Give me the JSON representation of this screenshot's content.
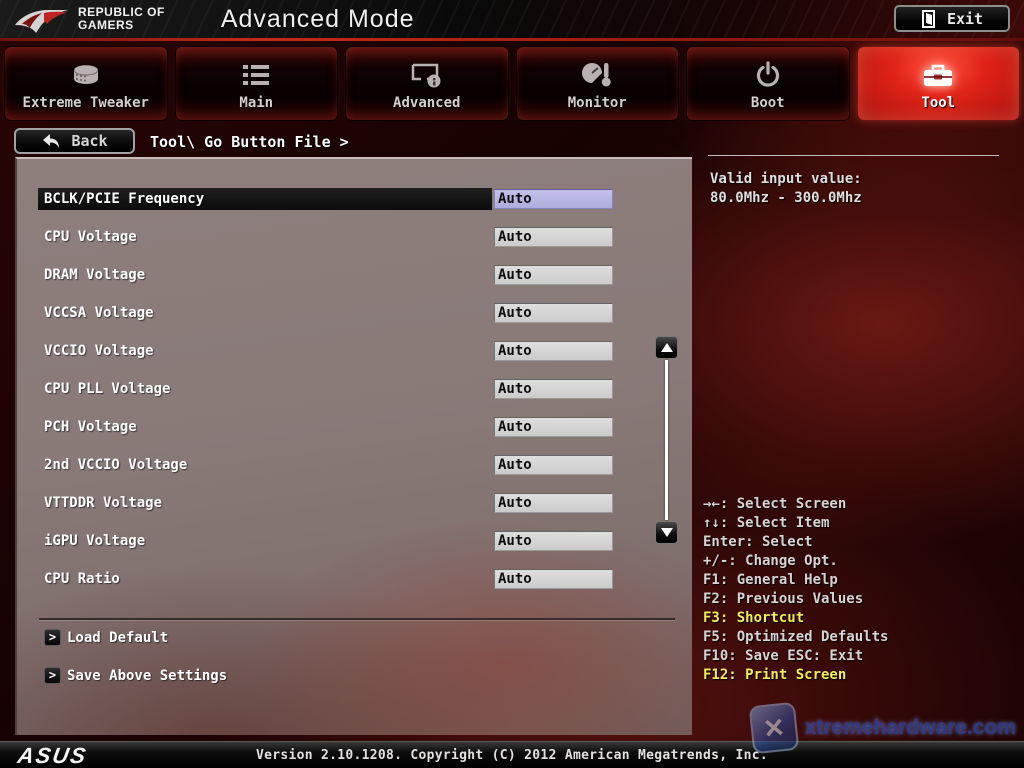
{
  "header": {
    "brand_line1": "REPUBLIC OF",
    "brand_line2": "GAMERS",
    "mode_title": "Advanced Mode",
    "exit_label": "Exit"
  },
  "tabs": [
    {
      "label": "Extreme Tweaker",
      "icon": "tweaker-knob-icon",
      "active": false
    },
    {
      "label": "Main",
      "icon": "list-icon",
      "active": false
    },
    {
      "label": "Advanced",
      "icon": "screen-info-icon",
      "active": false
    },
    {
      "label": "Monitor",
      "icon": "gauge-thermometer-icon",
      "active": false
    },
    {
      "label": "Boot",
      "icon": "power-icon",
      "active": false
    },
    {
      "label": "Tool",
      "icon": "toolbox-icon",
      "active": true
    }
  ],
  "breadcrumb": {
    "back_label": "Back",
    "path": "Tool\\ Go Button File >"
  },
  "settings": [
    {
      "label": "BCLK/PCIE Frequency",
      "value": "Auto",
      "selected": true
    },
    {
      "label": "CPU Voltage",
      "value": "Auto",
      "selected": false
    },
    {
      "label": "DRAM Voltage",
      "value": "Auto",
      "selected": false
    },
    {
      "label": "VCCSA Voltage",
      "value": "Auto",
      "selected": false
    },
    {
      "label": "VCCIO Voltage",
      "value": "Auto",
      "selected": false
    },
    {
      "label": "CPU PLL Voltage",
      "value": "Auto",
      "selected": false
    },
    {
      "label": "PCH Voltage",
      "value": "Auto",
      "selected": false
    },
    {
      "label": "2nd VCCIO Voltage",
      "value": "Auto",
      "selected": false
    },
    {
      "label": "VTTDDR Voltage",
      "value": "Auto",
      "selected": false
    },
    {
      "label": "iGPU Voltage",
      "value": "Auto",
      "selected": false
    },
    {
      "label": "CPU Ratio",
      "value": "Auto",
      "selected": false
    }
  ],
  "actions": [
    {
      "label": "Load Default"
    },
    {
      "label": "Save Above Settings"
    }
  ],
  "info_panel": {
    "line1": "Valid input value:",
    "line2": "80.0Mhz - 300.0Mhz"
  },
  "help_panel": {
    "lines": [
      {
        "text": "→←: Select Screen",
        "highlight": false
      },
      {
        "text": "↑↓: Select Item",
        "highlight": false
      },
      {
        "text": "Enter: Select",
        "highlight": false
      },
      {
        "text": "+/-: Change Opt.",
        "highlight": false
      },
      {
        "text": "F1: General Help",
        "highlight": false
      },
      {
        "text": "F2: Previous Values",
        "highlight": false
      },
      {
        "text": "F3: Shortcut",
        "highlight": true
      },
      {
        "text": "F5: Optimized Defaults",
        "highlight": false
      },
      {
        "text": "F10: Save  ESC: Exit",
        "highlight": false
      },
      {
        "text": "F12: Print Screen",
        "highlight": true
      }
    ]
  },
  "footer": {
    "brand": "ASUS",
    "version_text": "Version 2.10.1208. Copyright (C) 2012 American Megatrends, Inc."
  },
  "watermark": {
    "badge_glyph": "✕",
    "text": "xtremehardware.com"
  },
  "colors": {
    "active_tab_red": "#e02318",
    "selected_value_lavender": "#b5b3de",
    "panel_mauve": "#897a78",
    "help_highlight_yellow": "#f2ee52",
    "header_red_line": "#c62a1c"
  }
}
